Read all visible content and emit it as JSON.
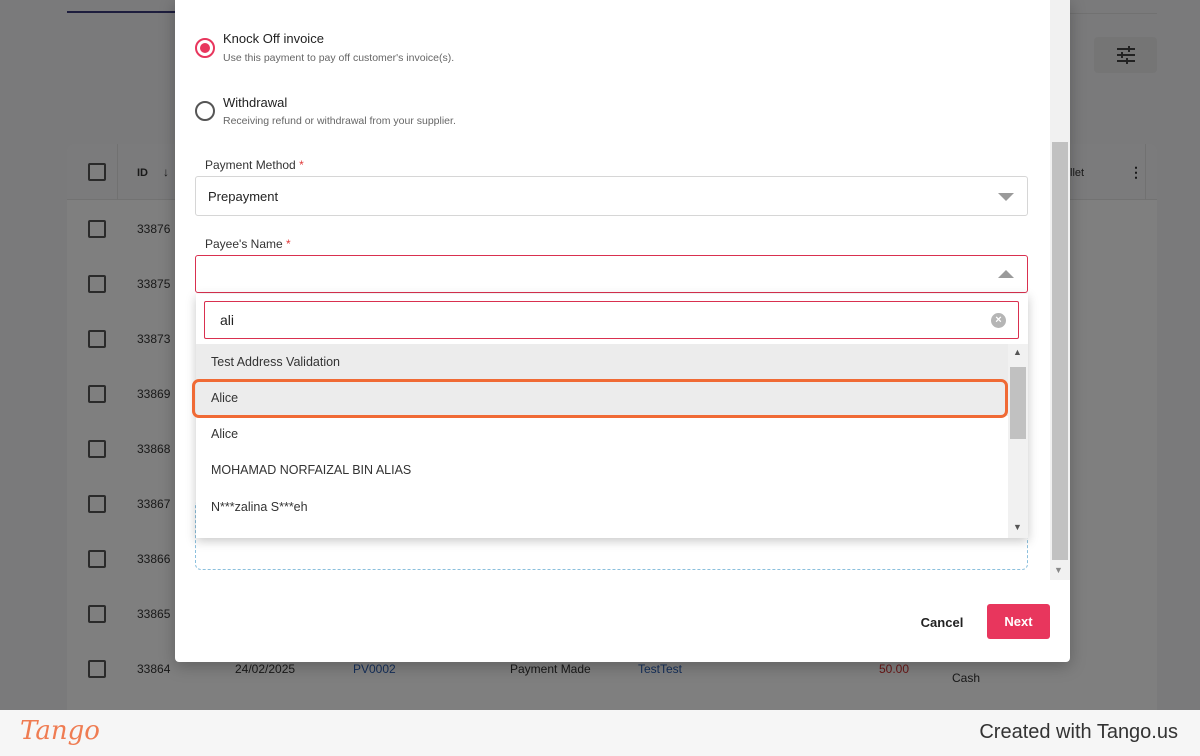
{
  "background": {
    "headers": {
      "id": "ID",
      "wallet": "llet"
    },
    "rows": [
      {
        "id": "33876"
      },
      {
        "id": "33875"
      },
      {
        "id": "33873"
      },
      {
        "id": "33869"
      },
      {
        "id": "33868"
      },
      {
        "id": "33867"
      },
      {
        "id": "33866"
      },
      {
        "id": "33865"
      },
      {
        "id": "33864",
        "date": "24/02/2025",
        "ref": "PV0002",
        "type": "Payment Made",
        "payee": "TestTest",
        "amount": "50.00",
        "wallet": "Cash"
      }
    ]
  },
  "modal": {
    "payment_type": {
      "options": [
        {
          "title": "Knock Off invoice",
          "subtitle": "Use this payment to pay off customer's invoice(s).",
          "selected": true
        },
        {
          "title": "Withdrawal",
          "subtitle": "Receiving refund or withdrawal from your supplier.",
          "selected": false
        }
      ]
    },
    "payment_method": {
      "label": "Payment Method",
      "required": "*",
      "value": "Prepayment"
    },
    "payee_name": {
      "label": "Payee's Name",
      "required": "*",
      "value": "",
      "search_value": "ali",
      "options": [
        "Test Address Validation",
        "Alice",
        "Alice",
        "MOHAMAD NORFAIZAL BIN ALIAS",
        "N***zalina S***eh"
      ],
      "highlighted_option": "Alice"
    },
    "buttons": {
      "cancel": "Cancel",
      "next": "Next"
    }
  },
  "footer": {
    "logo": "Tango",
    "credit": "Created with Tango.us"
  },
  "colors": {
    "accent": "#e8365d",
    "highlight": "#f06a35",
    "error_border": "#d9304f"
  }
}
